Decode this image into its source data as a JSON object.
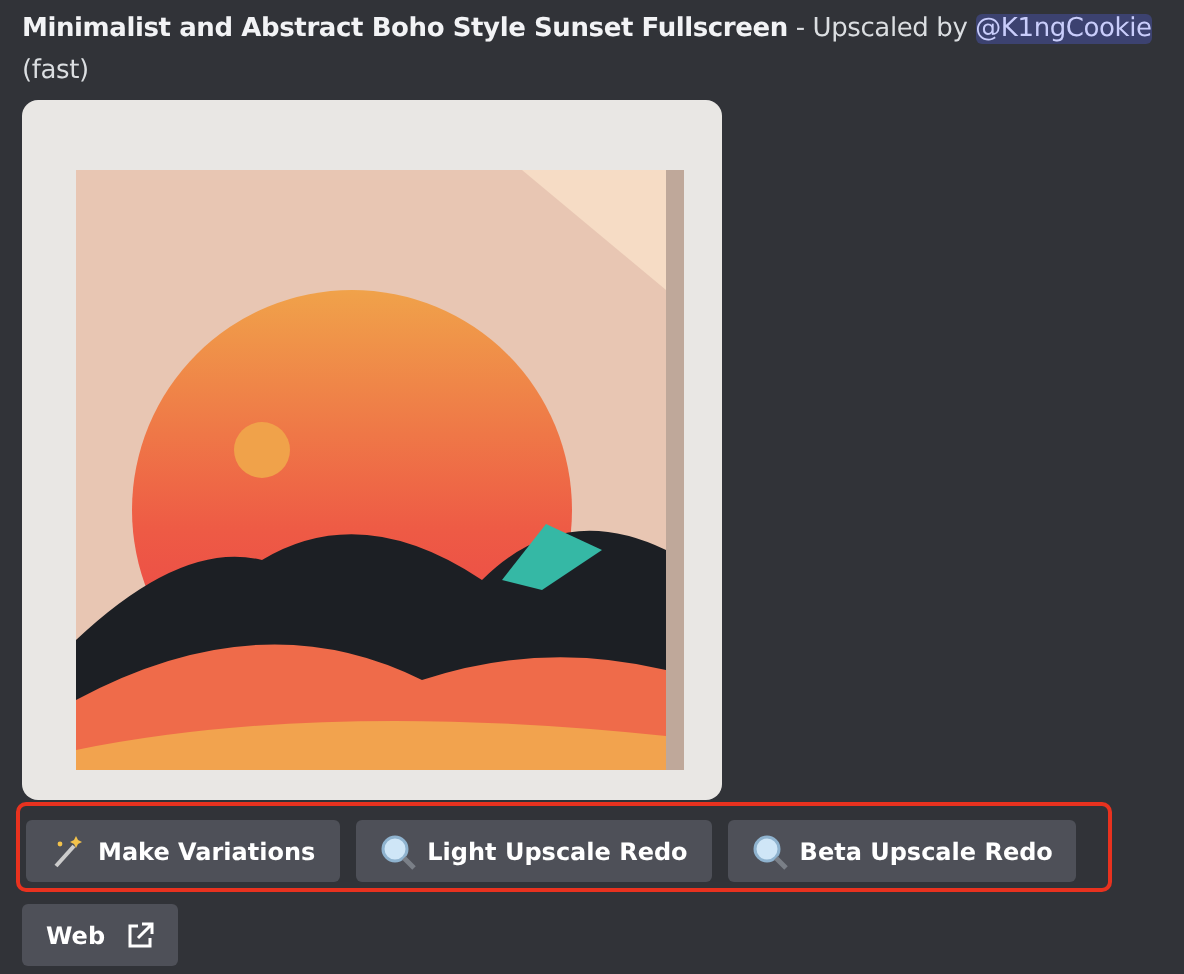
{
  "message": {
    "prompt": "Minimalist and Abstract Boho Style Sunset Fullscreen",
    "separator": " - Upscaled by ",
    "mention": "@K1ngCookie",
    "mode": "(fast)"
  },
  "actions": [
    {
      "kind": "variation",
      "label": "Make Variations"
    },
    {
      "kind": "upscale",
      "label": "Light Upscale Redo"
    },
    {
      "kind": "upscale",
      "label": "Beta Upscale Redo"
    }
  ],
  "highlighted": true,
  "link_button": {
    "label": "Web"
  }
}
